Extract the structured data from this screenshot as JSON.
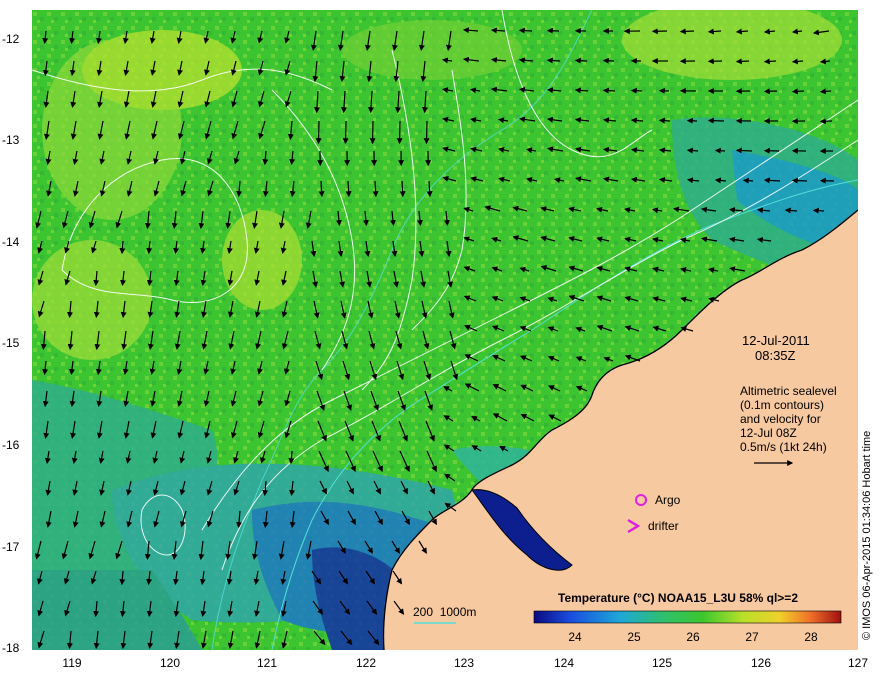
{
  "map": {
    "date": "12-Jul-2011",
    "time": "08:35Z",
    "description_lines": [
      "Altimetric sealevel",
      "(0.1m contours)",
      "and velocity for",
      "12-Jul 08Z",
      "0.5m/s (1kt 24h)"
    ],
    "credit": "© IMOS 06-Apr-2015 01:34:06 Hobart time",
    "legend_argo": "Argo",
    "legend_drifter": "drifter",
    "depth_label": "200  1000m",
    "lat_ticks": [
      "-12",
      "-13",
      "-14",
      "-15",
      "-16",
      "-17",
      "-18"
    ],
    "lon_ticks": [
      "119",
      "120",
      "121",
      "122",
      "123",
      "124",
      "125",
      "126",
      "127"
    ],
    "colorbar": {
      "title": "Temperature (°C) NOAA15_L3U 58% ql>=2",
      "ticks": [
        "24",
        "25",
        "26",
        "27",
        "28"
      ],
      "range": [
        23,
        29
      ]
    },
    "colors": {
      "land": "#f7c9a1",
      "sst_dominant": "#39c22e",
      "contour": "#ffffff",
      "isobath": "#53e0d8",
      "argo": "#e020e0"
    }
  }
}
